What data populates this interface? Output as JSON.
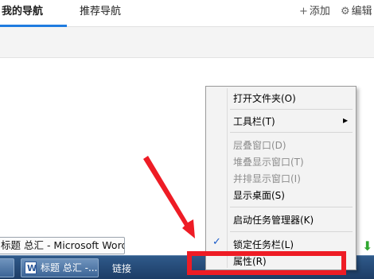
{
  "topnav": {
    "tab_active": "我的导航",
    "tab_2": "推荐导航",
    "add_icon": "plus-icon",
    "add_label": "添加",
    "settings_icon": "gear-icon",
    "settings_label": "编辑"
  },
  "taskbar": {
    "word_top_label": "标题 总汇 - Microsoft Word",
    "word_button_label": "标题 总汇 -...",
    "links_label": "链接"
  },
  "context_menu": {
    "items": [
      {
        "label": "打开文件夹(O)",
        "enabled": true
      },
      {
        "label": "工具栏(T)",
        "enabled": true,
        "submenu": true
      },
      {
        "label": "层叠窗口(D)",
        "enabled": false
      },
      {
        "label": "堆叠显示窗口(T)",
        "enabled": false
      },
      {
        "label": "并排显示窗口(I)",
        "enabled": false
      },
      {
        "label": "显示桌面(S)",
        "enabled": true
      },
      {
        "label": "启动任务管理器(K)",
        "enabled": true
      },
      {
        "label": "锁定任务栏(L)",
        "enabled": true,
        "checked": true
      },
      {
        "label": "属性(R)",
        "enabled": true
      }
    ],
    "check_mark": "✓",
    "submenu_arrow": "▶"
  },
  "colors": {
    "annotation_red": "#ee1c25",
    "accent_blue": "#1f7ce0",
    "taskbar_blue": "#1d3d66"
  }
}
